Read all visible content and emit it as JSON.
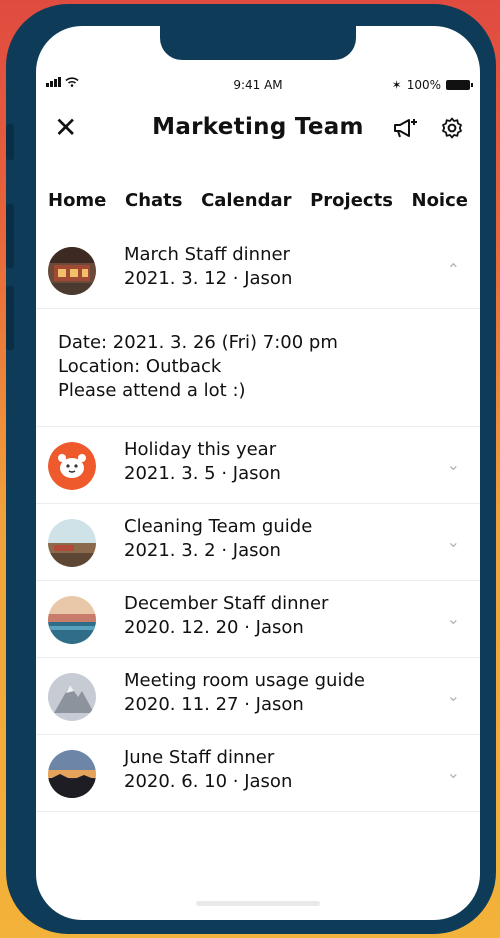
{
  "status_bar": {
    "time": "9:41 AM",
    "battery": "100%"
  },
  "header": {
    "title": "Marketing Team"
  },
  "tabs": [
    "Home",
    "Chats",
    "Calendar",
    "Projects",
    "Noice"
  ],
  "expanded_post": {
    "title": "March Staff dinner",
    "meta": "2021. 3. 12 · Jason",
    "details": [
      "Date: 2021. 3. 26 (Fri) 7:00 pm",
      "Location: Outback",
      "Please attend a lot :)"
    ]
  },
  "posts": [
    {
      "title": "Holiday this year",
      "meta": "2021. 3. 5 · Jason"
    },
    {
      "title": "Cleaning Team guide",
      "meta": "2021. 3. 2 · Jason"
    },
    {
      "title": "December Staff dinner",
      "meta": "2020. 12. 20 · Jason"
    },
    {
      "title": "Meeting room usage guide",
      "meta": "2020. 11. 27 · Jason"
    },
    {
      "title": "June Staff dinner",
      "meta": "2020. 6. 10 · Jason"
    }
  ],
  "icons": {
    "close": "close-icon",
    "announce": "megaphone-icon",
    "settings": "gear-icon",
    "expand": "chevron-down-icon",
    "collapse": "chevron-up-icon"
  },
  "colors": {
    "phone_frame": "#0e3b57",
    "holiday_avatar": "#ee5a2c"
  }
}
